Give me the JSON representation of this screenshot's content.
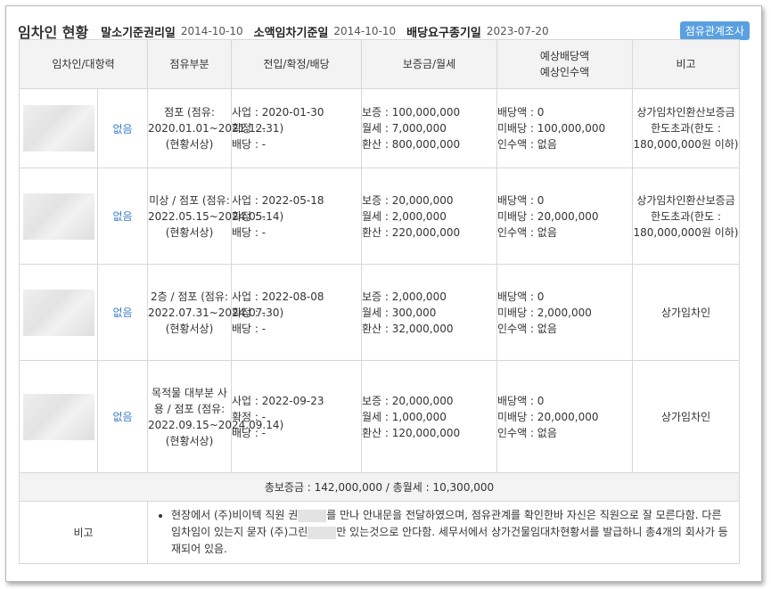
{
  "header": {
    "title": "임차인 현황",
    "fields": [
      {
        "label": "말소기준권리일",
        "value": "2014-10-10"
      },
      {
        "label": "소액임차기준일",
        "value": "2014-10-10"
      },
      {
        "label": "배당요구종기일",
        "value": "2023-07-20"
      }
    ],
    "button_label": "점유관계조사"
  },
  "columns": [
    "임차인/대항력",
    "점유부분",
    "전입/확정/배당",
    "보증금/월세",
    "예상배당액\n예상인수액",
    "비고"
  ],
  "rows": [
    {
      "priority": "없음",
      "occupancy": "점포 (점유: 2020.01.01~2021.12.31) (현황서상)",
      "dates": [
        "사업 : 2020-01-30",
        "확정 : -",
        "배당 : -"
      ],
      "deposit": [
        "보증 : 100,000,000",
        "월세 : 7,000,000",
        "환산 : 800,000,000"
      ],
      "dividend": [
        "배당액 : 0",
        "미배당 : 100,000,000",
        "인수액 : 없음"
      ],
      "note": "상가임차인환산보증금 한도초과(한도 : 180,000,000원 이하)"
    },
    {
      "priority": "없음",
      "occupancy": "미상 / 점포 (점유: 2022.05.15~2024.05.14) (현황서상)",
      "dates": [
        "사업 : 2022-05-18",
        "확정 : -",
        "배당 : -"
      ],
      "deposit": [
        "보증 : 20,000,000",
        "월세 : 2,000,000",
        "환산 : 220,000,000"
      ],
      "dividend": [
        "배당액 : 0",
        "미배당 : 20,000,000",
        "인수액 : 없음"
      ],
      "note": "상가임차인환산보증금 한도초과(한도 : 180,000,000원 이하)"
    },
    {
      "priority": "없음",
      "occupancy": "2층 / 점포 (점유: 2022.07.31~2024.07.30) (현황서상)",
      "dates": [
        "사업 : 2022-08-08",
        "확정 : -",
        "배당 : -"
      ],
      "deposit": [
        "보증 : 2,000,000",
        "월세 : 300,000",
        "환산 : 32,000,000"
      ],
      "dividend": [
        "배당액 : 0",
        "미배당 : 2,000,000",
        "인수액 : 없음"
      ],
      "note": "상가임차인"
    },
    {
      "priority": "없음",
      "occupancy": "목적물 대부분 사용 / 점포 (점유: 2022.09.15~2024.09.14) (현황서상)",
      "dates": [
        "사업 : 2022-09-23",
        "확정 : -",
        "배당 : -"
      ],
      "deposit": [
        "보증 : 20,000,000",
        "월세 : 1,000,000",
        "환산 : 120,000,000"
      ],
      "dividend": [
        "배당액 : 0",
        "미배당 : 20,000,000",
        "인수액 : 없음"
      ],
      "note": "상가임차인"
    }
  ],
  "total": "총보증금 : 142,000,000  /  총월세 : 10,300,000",
  "remarks": {
    "label": "비고",
    "text_part1": "현장에서 (주)비이텍 직원 권",
    "text_part2": "를 만나 안내문을 전달하였으며, 점유관계를 확인한바 자신은 직원으로 잘 모른다함. 다른 임차임이 있는지 묻자 (주)그린",
    "text_part3": "만 있는것으로 안다함. 세무서에서 상가건물임대차현황서를 발급하니 총4개의 회사가 등재되어 있음."
  }
}
